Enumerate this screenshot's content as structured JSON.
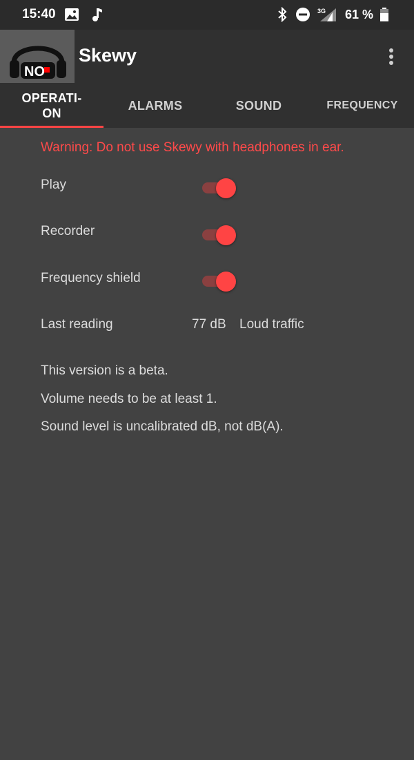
{
  "status_bar": {
    "time": "15:40",
    "battery_percent": "61 %",
    "icons": [
      "image-icon",
      "music-note-icon",
      "bluetooth-icon",
      "do-not-disturb-icon",
      "signal-3g-icon",
      "battery-icon"
    ],
    "network_label": "3G"
  },
  "app_bar": {
    "title": "Skewy",
    "logo_text": "NO"
  },
  "tabs": [
    {
      "label": "OPERATI-\nON",
      "active": true
    },
    {
      "label": "ALARMS",
      "active": false
    },
    {
      "label": "SOUND",
      "active": false
    },
    {
      "label": "FREQUENCY",
      "active": false
    }
  ],
  "colors": {
    "accent": "#ff4444",
    "warning": "#ff4a4a",
    "background": "#424242",
    "toolbar": "#303030"
  },
  "operation": {
    "warning": "Warning: Do not use Skewy with headphones in ear.",
    "switches": [
      {
        "label": "Play",
        "on": true
      },
      {
        "label": "Recorder",
        "on": true
      },
      {
        "label": "Frequency shield",
        "on": true
      }
    ],
    "last_reading_label": "Last reading",
    "last_reading_value": "77 dB",
    "last_reading_desc": "Loud traffic",
    "notes": [
      "This version is a beta.",
      "Volume needs to be at least 1.",
      "Sound level is uncalibrated dB, not dB(A)."
    ]
  }
}
